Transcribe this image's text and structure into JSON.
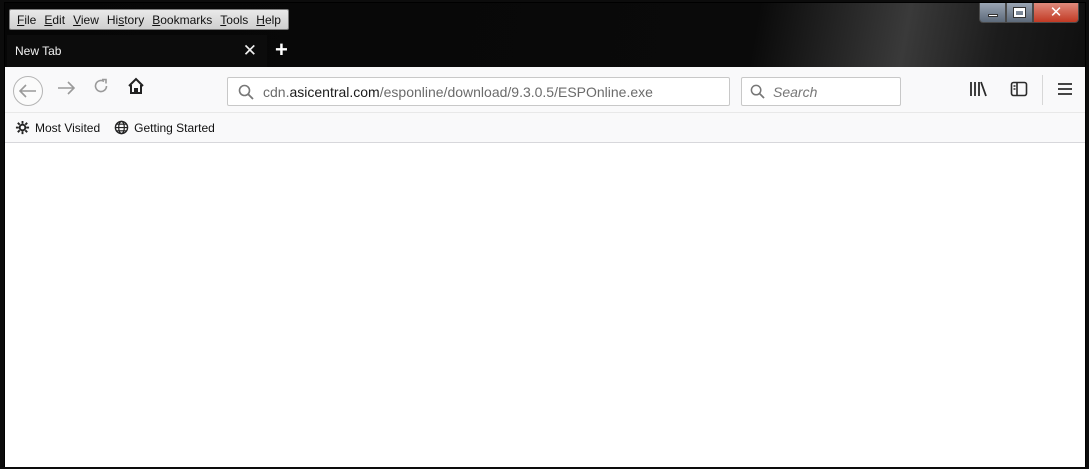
{
  "menu": {
    "items": [
      "File",
      "Edit",
      "View",
      "History",
      "Bookmarks",
      "Tools",
      "Help"
    ],
    "accelerators": [
      "F",
      "E",
      "V",
      "s",
      "B",
      "T",
      "H"
    ]
  },
  "tab": {
    "title": "New Tab"
  },
  "nav": {
    "url_prefix": "cdn.",
    "url_domain": "asicentral.com",
    "url_path": "/esponline/download/9.3.0.5/ESPOnline.exe",
    "search_placeholder": "Search"
  },
  "bookmarks": {
    "items": [
      "Most Visited",
      "Getting Started"
    ]
  },
  "icons": {
    "back": "back-arrow-icon",
    "forward": "forward-arrow-icon",
    "reload": "reload-icon",
    "home": "home-icon",
    "url_search": "search-icon",
    "search": "search-icon",
    "library": "library-icon",
    "sidebar": "sidebar-icon",
    "menu": "hamburger-menu-icon",
    "most_visited": "gear-icon",
    "getting_started": "globe-icon"
  },
  "colors": {
    "toolbar_bg": "#f9f9fa",
    "tab_bg": "#0c0c0c",
    "close_button": "#c23a24"
  }
}
